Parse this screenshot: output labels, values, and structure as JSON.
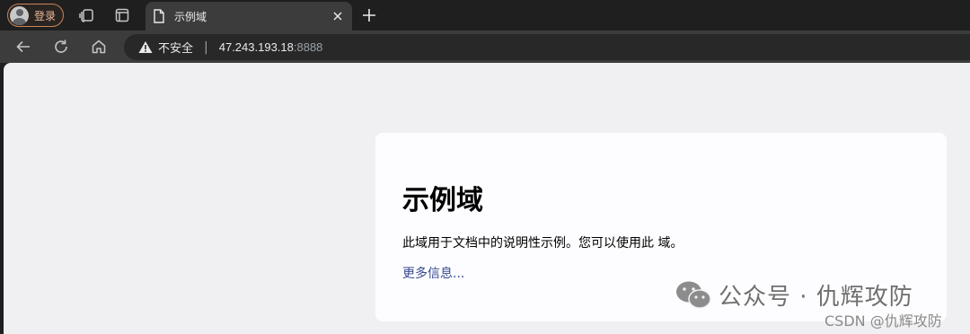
{
  "browser": {
    "profile": {
      "label": "登录",
      "icon": "avatar-icon"
    },
    "tab": {
      "title": "示例域",
      "icon": "page-icon"
    },
    "new_tab_icon": "plus-icon",
    "toolbar": {
      "security_label": "不安全",
      "url_host": "47.243.193.18",
      "url_port": ":8888"
    }
  },
  "page": {
    "title": "示例域",
    "description": "此域用于文档中的说明性示例。您可以使用此 域。",
    "more_info_link": "更多信息..."
  },
  "watermarks": {
    "wechat": "公众号 · 仇辉攻防",
    "csdn": "CSDN @仇辉攻防"
  },
  "colors": {
    "link": "#38488f",
    "profile_accent": "#c8845a"
  }
}
